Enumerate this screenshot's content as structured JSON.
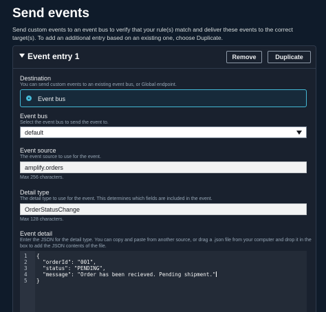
{
  "page": {
    "title": "Send events",
    "description": "Send custom events to an event bus to verify that your rule(s) match and deliver these events to the correct target(s). To add an additional entry based on an existing one, choose Duplicate."
  },
  "entry": {
    "title": "Event entry 1",
    "remove_label": "Remove",
    "duplicate_label": "Duplicate"
  },
  "destination": {
    "label": "Destination",
    "hint": "You can send custom events to an existing event bus, or Global endpoint.",
    "option_label": "Event bus",
    "selected": true
  },
  "event_bus": {
    "label": "Event bus",
    "hint": "Select the event bus to send the event to.",
    "value": "default"
  },
  "event_source": {
    "label": "Event source",
    "hint": "The event source to use for the event.",
    "value": "amplify.orders",
    "constraint": "Max 256 characters."
  },
  "detail_type": {
    "label": "Detail type",
    "hint": "The detail type to use for the event. This determines which fields are included in the event.",
    "value": "OrderStatusChange",
    "constraint": "Max 128 characters."
  },
  "event_detail": {
    "label": "Event detail",
    "hint_line1": "Enter the JSON for the detail type. You can copy and paste from another source, or drag a .json file from your computer and drop it in the",
    "hint_line2": "box to add the JSON contents of the file.",
    "lines": [
      {
        "num": "1",
        "text": "{"
      },
      {
        "num": "2",
        "text": "  \"orderId\": \"001\","
      },
      {
        "num": "3",
        "text": "  \"status\": \"PENDING\","
      },
      {
        "num": "4",
        "text": "  \"message\": \"Order has been recieved. Pending shipment.\""
      },
      {
        "num": "5",
        "text": "}"
      }
    ]
  },
  "colors": {
    "background": "#0f1b2a",
    "panel": "#19212e",
    "accent": "#44b9d6"
  }
}
